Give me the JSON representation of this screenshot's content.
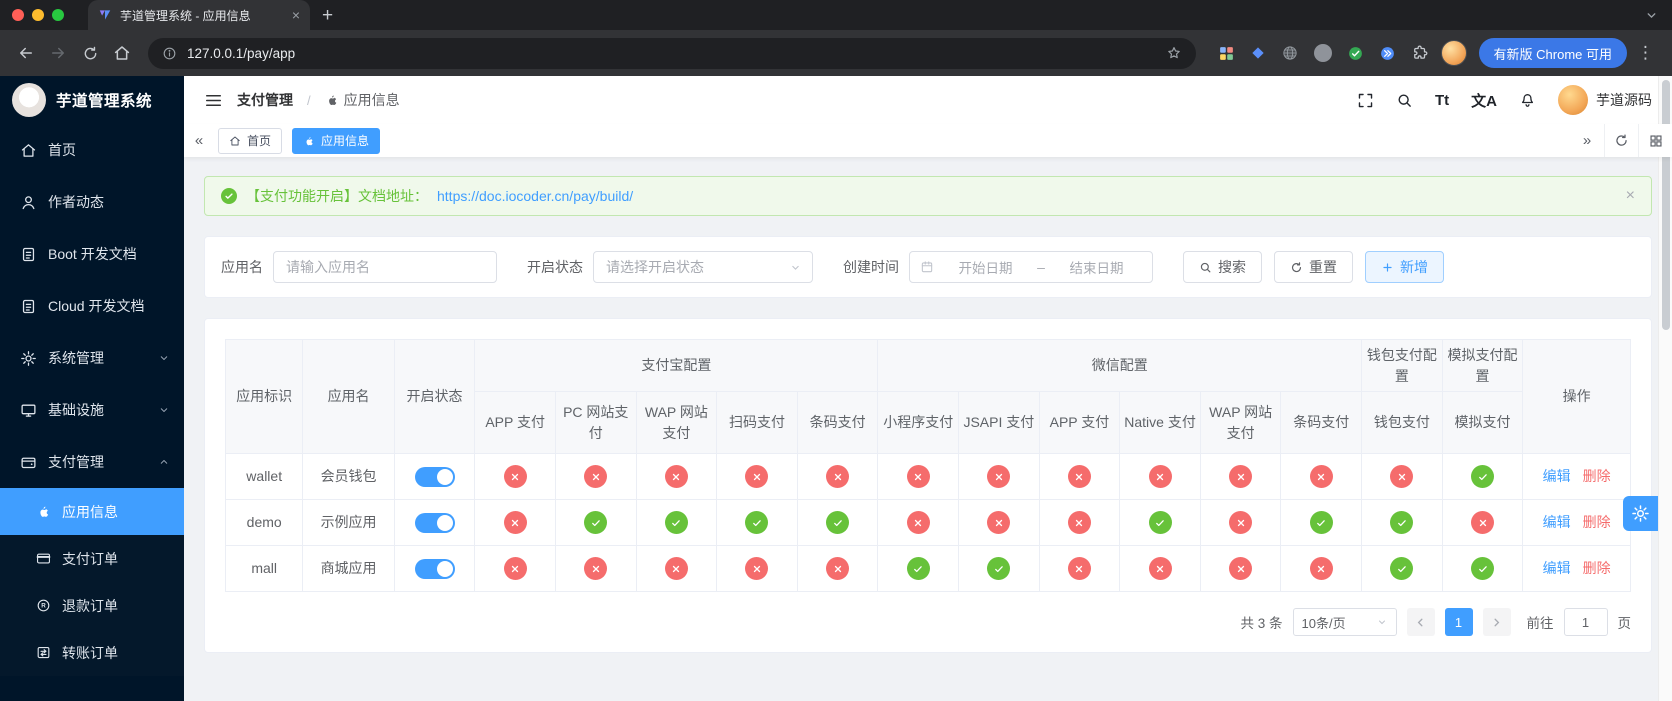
{
  "colors": {
    "accent": "#409eff",
    "success": "#67c23a",
    "danger": "#f56c6c",
    "sidebar_bg": "#001529"
  },
  "glyphs": {
    "tab_close": "×",
    "new_tab": "+",
    "kebab": "⋮",
    "tags_left": "«",
    "tags_right": "»",
    "alert_close": "×",
    "font_size": "Tt",
    "translate": "文A"
  },
  "browser": {
    "tab_title": "芋道管理系统 - 应用信息",
    "url": "127.0.0.1/pay/app",
    "update_button": "有新版 Chrome 可用"
  },
  "sidebar": {
    "logo_title": "芋道管理系统",
    "items": [
      {
        "label": "首页",
        "icon": "home"
      },
      {
        "label": "作者动态",
        "icon": "user"
      },
      {
        "label": "Boot 开发文档",
        "icon": "doc"
      },
      {
        "label": "Cloud 开发文档",
        "icon": "doc"
      },
      {
        "label": "系统管理",
        "icon": "gear",
        "chevron": "down"
      },
      {
        "label": "基础设施",
        "icon": "monitor",
        "chevron": "down"
      },
      {
        "label": "支付管理",
        "icon": "wallet",
        "chevron": "up"
      }
    ],
    "subitems": [
      {
        "label": "应用信息",
        "icon": "apple",
        "active": true
      },
      {
        "label": "支付订单",
        "icon": "card"
      },
      {
        "label": "退款订单",
        "icon": "registered"
      },
      {
        "label": "转账订单",
        "icon": "transfer"
      }
    ]
  },
  "header": {
    "breadcrumb": [
      {
        "label": "支付管理"
      },
      {
        "label": "应用信息",
        "icon": "apple"
      }
    ],
    "separator": "/",
    "user_name": "芋道源码"
  },
  "tagbar": {
    "tabs": [
      {
        "label": "首页",
        "icon": "home",
        "active": false
      },
      {
        "label": "应用信息",
        "icon": "apple",
        "active": true
      }
    ]
  },
  "alert": {
    "text": "【支付功能开启】文档地址：",
    "link": "https://doc.iocoder.cn/pay/build/"
  },
  "filters": {
    "name_label": "应用名",
    "name_placeholder": "请输入应用名",
    "status_label": "开启状态",
    "status_placeholder": "请选择开启状态",
    "time_label": "创建时间",
    "date_start": "开始日期",
    "date_sep": "–",
    "date_end": "结束日期",
    "search": "搜索",
    "reset": "重置",
    "add": "新增"
  },
  "table": {
    "fixed_columns": [
      "应用标识",
      "应用名",
      "开启状态"
    ],
    "groups": [
      {
        "label": "支付宝配置",
        "children": [
          "APP 支付",
          "PC 网站支付",
          "WAP 网站支付",
          "扫码支付",
          "条码支付"
        ]
      },
      {
        "label": "微信配置",
        "children": [
          "小程序支付",
          "JSAPI 支付",
          "APP 支付",
          "Native 支付",
          "WAP 网站支付",
          "条码支付"
        ]
      },
      {
        "label": "钱包支付配置",
        "children": [
          "钱包支付"
        ]
      },
      {
        "label": "模拟支付配置",
        "children": [
          "模拟支付"
        ]
      }
    ],
    "actions_column": "操作",
    "actions": [
      "编辑",
      "删除"
    ],
    "rows": [
      {
        "app_id": "wallet",
        "app_name": "会员钱包",
        "enabled": true,
        "channels": [
          false,
          false,
          false,
          false,
          false,
          false,
          false,
          false,
          false,
          false,
          false,
          false,
          true
        ]
      },
      {
        "app_id": "demo",
        "app_name": "示例应用",
        "enabled": true,
        "channels": [
          false,
          true,
          true,
          true,
          true,
          false,
          false,
          false,
          true,
          false,
          true,
          true,
          false
        ]
      },
      {
        "app_id": "mall",
        "app_name": "商城应用",
        "enabled": true,
        "channels": [
          false,
          false,
          false,
          false,
          false,
          true,
          true,
          false,
          false,
          false,
          false,
          true,
          true
        ]
      }
    ]
  },
  "pagination": {
    "total": "共 3 条",
    "page_size": "10条/页",
    "current_page": "1",
    "goto_label": "前往",
    "goto_value": "1",
    "unit_label": "页"
  }
}
